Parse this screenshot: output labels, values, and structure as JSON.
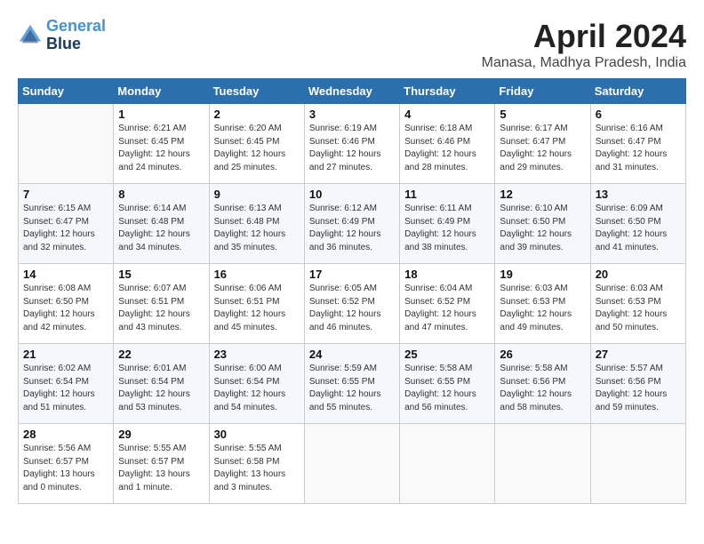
{
  "header": {
    "logo_line1": "General",
    "logo_line2": "Blue",
    "month_year": "April 2024",
    "location": "Manasa, Madhya Pradesh, India"
  },
  "weekdays": [
    "Sunday",
    "Monday",
    "Tuesday",
    "Wednesday",
    "Thursday",
    "Friday",
    "Saturday"
  ],
  "weeks": [
    [
      {
        "day": "",
        "sunrise": "",
        "sunset": "",
        "daylight": ""
      },
      {
        "day": "1",
        "sunrise": "Sunrise: 6:21 AM",
        "sunset": "Sunset: 6:45 PM",
        "daylight": "Daylight: 12 hours and 24 minutes."
      },
      {
        "day": "2",
        "sunrise": "Sunrise: 6:20 AM",
        "sunset": "Sunset: 6:45 PM",
        "daylight": "Daylight: 12 hours and 25 minutes."
      },
      {
        "day": "3",
        "sunrise": "Sunrise: 6:19 AM",
        "sunset": "Sunset: 6:46 PM",
        "daylight": "Daylight: 12 hours and 27 minutes."
      },
      {
        "day": "4",
        "sunrise": "Sunrise: 6:18 AM",
        "sunset": "Sunset: 6:46 PM",
        "daylight": "Daylight: 12 hours and 28 minutes."
      },
      {
        "day": "5",
        "sunrise": "Sunrise: 6:17 AM",
        "sunset": "Sunset: 6:47 PM",
        "daylight": "Daylight: 12 hours and 29 minutes."
      },
      {
        "day": "6",
        "sunrise": "Sunrise: 6:16 AM",
        "sunset": "Sunset: 6:47 PM",
        "daylight": "Daylight: 12 hours and 31 minutes."
      }
    ],
    [
      {
        "day": "7",
        "sunrise": "Sunrise: 6:15 AM",
        "sunset": "Sunset: 6:47 PM",
        "daylight": "Daylight: 12 hours and 32 minutes."
      },
      {
        "day": "8",
        "sunrise": "Sunrise: 6:14 AM",
        "sunset": "Sunset: 6:48 PM",
        "daylight": "Daylight: 12 hours and 34 minutes."
      },
      {
        "day": "9",
        "sunrise": "Sunrise: 6:13 AM",
        "sunset": "Sunset: 6:48 PM",
        "daylight": "Daylight: 12 hours and 35 minutes."
      },
      {
        "day": "10",
        "sunrise": "Sunrise: 6:12 AM",
        "sunset": "Sunset: 6:49 PM",
        "daylight": "Daylight: 12 hours and 36 minutes."
      },
      {
        "day": "11",
        "sunrise": "Sunrise: 6:11 AM",
        "sunset": "Sunset: 6:49 PM",
        "daylight": "Daylight: 12 hours and 38 minutes."
      },
      {
        "day": "12",
        "sunrise": "Sunrise: 6:10 AM",
        "sunset": "Sunset: 6:50 PM",
        "daylight": "Daylight: 12 hours and 39 minutes."
      },
      {
        "day": "13",
        "sunrise": "Sunrise: 6:09 AM",
        "sunset": "Sunset: 6:50 PM",
        "daylight": "Daylight: 12 hours and 41 minutes."
      }
    ],
    [
      {
        "day": "14",
        "sunrise": "Sunrise: 6:08 AM",
        "sunset": "Sunset: 6:50 PM",
        "daylight": "Daylight: 12 hours and 42 minutes."
      },
      {
        "day": "15",
        "sunrise": "Sunrise: 6:07 AM",
        "sunset": "Sunset: 6:51 PM",
        "daylight": "Daylight: 12 hours and 43 minutes."
      },
      {
        "day": "16",
        "sunrise": "Sunrise: 6:06 AM",
        "sunset": "Sunset: 6:51 PM",
        "daylight": "Daylight: 12 hours and 45 minutes."
      },
      {
        "day": "17",
        "sunrise": "Sunrise: 6:05 AM",
        "sunset": "Sunset: 6:52 PM",
        "daylight": "Daylight: 12 hours and 46 minutes."
      },
      {
        "day": "18",
        "sunrise": "Sunrise: 6:04 AM",
        "sunset": "Sunset: 6:52 PM",
        "daylight": "Daylight: 12 hours and 47 minutes."
      },
      {
        "day": "19",
        "sunrise": "Sunrise: 6:03 AM",
        "sunset": "Sunset: 6:53 PM",
        "daylight": "Daylight: 12 hours and 49 minutes."
      },
      {
        "day": "20",
        "sunrise": "Sunrise: 6:03 AM",
        "sunset": "Sunset: 6:53 PM",
        "daylight": "Daylight: 12 hours and 50 minutes."
      }
    ],
    [
      {
        "day": "21",
        "sunrise": "Sunrise: 6:02 AM",
        "sunset": "Sunset: 6:54 PM",
        "daylight": "Daylight: 12 hours and 51 minutes."
      },
      {
        "day": "22",
        "sunrise": "Sunrise: 6:01 AM",
        "sunset": "Sunset: 6:54 PM",
        "daylight": "Daylight: 12 hours and 53 minutes."
      },
      {
        "day": "23",
        "sunrise": "Sunrise: 6:00 AM",
        "sunset": "Sunset: 6:54 PM",
        "daylight": "Daylight: 12 hours and 54 minutes."
      },
      {
        "day": "24",
        "sunrise": "Sunrise: 5:59 AM",
        "sunset": "Sunset: 6:55 PM",
        "daylight": "Daylight: 12 hours and 55 minutes."
      },
      {
        "day": "25",
        "sunrise": "Sunrise: 5:58 AM",
        "sunset": "Sunset: 6:55 PM",
        "daylight": "Daylight: 12 hours and 56 minutes."
      },
      {
        "day": "26",
        "sunrise": "Sunrise: 5:58 AM",
        "sunset": "Sunset: 6:56 PM",
        "daylight": "Daylight: 12 hours and 58 minutes."
      },
      {
        "day": "27",
        "sunrise": "Sunrise: 5:57 AM",
        "sunset": "Sunset: 6:56 PM",
        "daylight": "Daylight: 12 hours and 59 minutes."
      }
    ],
    [
      {
        "day": "28",
        "sunrise": "Sunrise: 5:56 AM",
        "sunset": "Sunset: 6:57 PM",
        "daylight": "Daylight: 13 hours and 0 minutes."
      },
      {
        "day": "29",
        "sunrise": "Sunrise: 5:55 AM",
        "sunset": "Sunset: 6:57 PM",
        "daylight": "Daylight: 13 hours and 1 minute."
      },
      {
        "day": "30",
        "sunrise": "Sunrise: 5:55 AM",
        "sunset": "Sunset: 6:58 PM",
        "daylight": "Daylight: 13 hours and 3 minutes."
      },
      {
        "day": "",
        "sunrise": "",
        "sunset": "",
        "daylight": ""
      },
      {
        "day": "",
        "sunrise": "",
        "sunset": "",
        "daylight": ""
      },
      {
        "day": "",
        "sunrise": "",
        "sunset": "",
        "daylight": ""
      },
      {
        "day": "",
        "sunrise": "",
        "sunset": "",
        "daylight": ""
      }
    ]
  ]
}
